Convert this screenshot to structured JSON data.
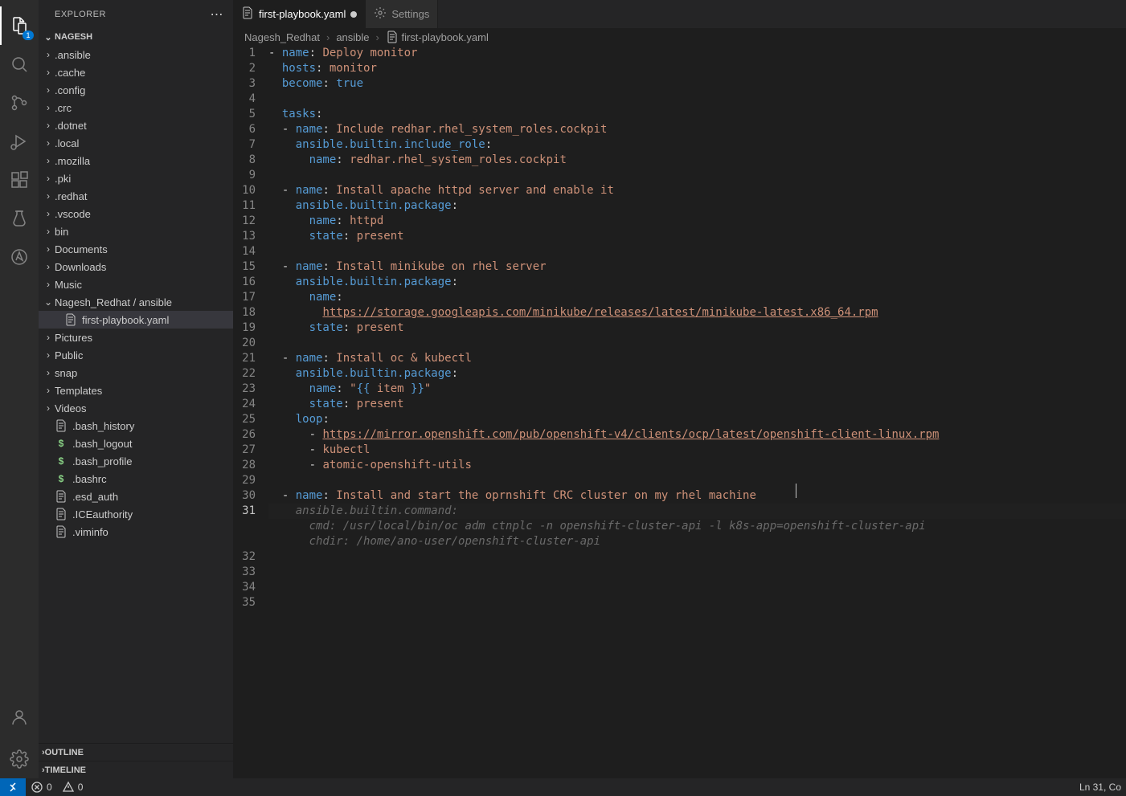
{
  "explorer": {
    "title": "EXPLORER",
    "workspace": "NAGESH",
    "outline": "OUTLINE",
    "timeline": "TIMELINE",
    "tree": [
      {
        "label": ".ansible",
        "type": "folder",
        "depth": 1
      },
      {
        "label": ".cache",
        "type": "folder",
        "depth": 1
      },
      {
        "label": ".config",
        "type": "folder",
        "depth": 1
      },
      {
        "label": ".crc",
        "type": "folder",
        "depth": 1
      },
      {
        "label": ".dotnet",
        "type": "folder",
        "depth": 1
      },
      {
        "label": ".local",
        "type": "folder",
        "depth": 1
      },
      {
        "label": ".mozilla",
        "type": "folder",
        "depth": 1
      },
      {
        "label": ".pki",
        "type": "folder",
        "depth": 1
      },
      {
        "label": ".redhat",
        "type": "folder",
        "depth": 1
      },
      {
        "label": ".vscode",
        "type": "folder",
        "depth": 1
      },
      {
        "label": "bin",
        "type": "folder",
        "depth": 1
      },
      {
        "label": "Documents",
        "type": "folder",
        "depth": 1
      },
      {
        "label": "Downloads",
        "type": "folder",
        "depth": 1
      },
      {
        "label": "Music",
        "type": "folder",
        "depth": 1
      },
      {
        "label": "Nagesh_Redhat / ansible",
        "type": "folder-open",
        "depth": 1
      },
      {
        "label": "first-playbook.yaml",
        "type": "file",
        "depth": 2,
        "selected": true
      },
      {
        "label": "Pictures",
        "type": "folder",
        "depth": 1
      },
      {
        "label": "Public",
        "type": "folder",
        "depth": 1
      },
      {
        "label": "snap",
        "type": "folder",
        "depth": 1
      },
      {
        "label": "Templates",
        "type": "folder",
        "depth": 1
      },
      {
        "label": "Videos",
        "type": "folder",
        "depth": 1
      },
      {
        "label": ".bash_history",
        "type": "file",
        "depth": 1
      },
      {
        "label": ".bash_logout",
        "type": "file-dollar",
        "depth": 1
      },
      {
        "label": ".bash_profile",
        "type": "file-dollar",
        "depth": 1
      },
      {
        "label": ".bashrc",
        "type": "file-dollar",
        "depth": 1
      },
      {
        "label": ".esd_auth",
        "type": "file",
        "depth": 1
      },
      {
        "label": ".ICEauthority",
        "type": "file",
        "depth": 1
      },
      {
        "label": ".viminfo",
        "type": "file",
        "depth": 1
      }
    ]
  },
  "tabs": [
    {
      "label": "first-playbook.yaml",
      "modified": true,
      "active": true
    },
    {
      "label": "Settings",
      "modified": false,
      "active": false,
      "icon": "gear"
    }
  ],
  "breadcrumbs": [
    "Nagesh_Redhat",
    "ansible",
    "first-playbook.yaml"
  ],
  "activity_badge": "1",
  "code_lines": [
    {
      "n": 1,
      "html": "<span class='p'>- </span><span class='k'>name</span><span class='p'>: </span><span class='s'>Deploy monitor</span>"
    },
    {
      "n": 2,
      "html": "  <span class='k'>hosts</span><span class='p'>: </span><span class='s'>monitor</span>"
    },
    {
      "n": 3,
      "html": "  <span class='k'>become</span><span class='p'>: </span><span class='v'>true</span>"
    },
    {
      "n": 4,
      "html": ""
    },
    {
      "n": 5,
      "html": "  <span class='k'>tasks</span><span class='p'>:</span>"
    },
    {
      "n": 6,
      "html": "  <span class='p'>- </span><span class='k'>name</span><span class='p'>: </span><span class='s'>Include redhar.rhel_system_roles.cockpit</span>"
    },
    {
      "n": 7,
      "html": "    <span class='k'>ansible.builtin.include_role</span><span class='p'>:</span>"
    },
    {
      "n": 8,
      "html": "      <span class='k'>name</span><span class='p'>: </span><span class='s'>redhar.rhel_system_roles.cockpit</span>"
    },
    {
      "n": 9,
      "html": ""
    },
    {
      "n": 10,
      "html": "  <span class='p'>- </span><span class='k'>name</span><span class='p'>: </span><span class='s'>Install apache httpd server and enable it</span>"
    },
    {
      "n": 11,
      "html": "    <span class='k'>ansible.builtin.package</span><span class='p'>:</span>"
    },
    {
      "n": 12,
      "html": "      <span class='k'>name</span><span class='p'>: </span><span class='s'>httpd</span>"
    },
    {
      "n": 13,
      "html": "      <span class='k'>state</span><span class='p'>: </span><span class='s'>present</span>"
    },
    {
      "n": 14,
      "html": ""
    },
    {
      "n": 15,
      "html": "  <span class='p'>- </span><span class='k'>name</span><span class='p'>: </span><span class='s'>Install minikube on rhel server</span>"
    },
    {
      "n": 16,
      "html": "    <span class='k'>ansible.builtin.package</span><span class='p'>:</span>"
    },
    {
      "n": 17,
      "html": "      <span class='k'>name</span><span class='p'>:</span>"
    },
    {
      "n": 18,
      "html": "        <span class='u'>https://storage.googleapis.com/minikube/releases/latest/minikube-latest.x86_64.rpm</span>"
    },
    {
      "n": 19,
      "html": "      <span class='k'>state</span><span class='p'>: </span><span class='s'>present</span>"
    },
    {
      "n": 20,
      "html": ""
    },
    {
      "n": 21,
      "html": "  <span class='p'>- </span><span class='k'>name</span><span class='p'>: </span><span class='s'>Install oc &amp; kubectl</span>"
    },
    {
      "n": 22,
      "html": "    <span class='k'>ansible.builtin.package</span><span class='p'>:</span>"
    },
    {
      "n": 23,
      "html": "      <span class='k'>name</span><span class='p'>: </span><span class='s'>\"</span><span class='tmpl'>{{ </span><span class='s'>item</span><span class='tmpl'> }}</span><span class='s'>\"</span>"
    },
    {
      "n": 24,
      "html": "      <span class='k'>state</span><span class='p'>: </span><span class='s'>present</span>"
    },
    {
      "n": 25,
      "html": "    <span class='k'>loop</span><span class='p'>:</span>"
    },
    {
      "n": 26,
      "html": "      <span class='p'>- </span><span class='u'>https://mirror.openshift.com/pub/openshift-v4/clients/ocp/latest/openshift-client-linux.rpm</span>"
    },
    {
      "n": 27,
      "html": "      <span class='p'>- </span><span class='s'>kubectl</span>"
    },
    {
      "n": 28,
      "html": "      <span class='p'>- </span><span class='s'>atomic-openshift-utils</span>"
    },
    {
      "n": 29,
      "html": ""
    },
    {
      "n": 30,
      "html": "  <span class='p'>- </span><span class='k'>name</span><span class='p'>: </span><span class='s'>Install and start the oprnshift CRC cluster on my rhel machine</span>"
    },
    {
      "n": 31,
      "html": "    <span class='sug'>ansible.builtin.command:</span>",
      "current": true
    },
    {
      "n": 32,
      "html": "      <span class='sug'>cmd: /usr/local/bin/oc adm ctnplc -n openshift-cluster-api -l k8s-app=openshift-cluster-api</span>",
      "suggestion": true
    },
    {
      "n": 33,
      "html": "      <span class='sug'>chdir: /home/ano-user/openshift-cluster-api</span>",
      "suggestion": true
    },
    {
      "n": 32,
      "html": "",
      "realnum": true
    },
    {
      "n": 33,
      "html": "",
      "realnum": true
    },
    {
      "n": 34,
      "html": "",
      "realnum": true
    },
    {
      "n": 35,
      "html": "",
      "realnum": true
    }
  ],
  "status": {
    "errors": "0",
    "warnings": "0",
    "position": "Ln 31, Co"
  }
}
